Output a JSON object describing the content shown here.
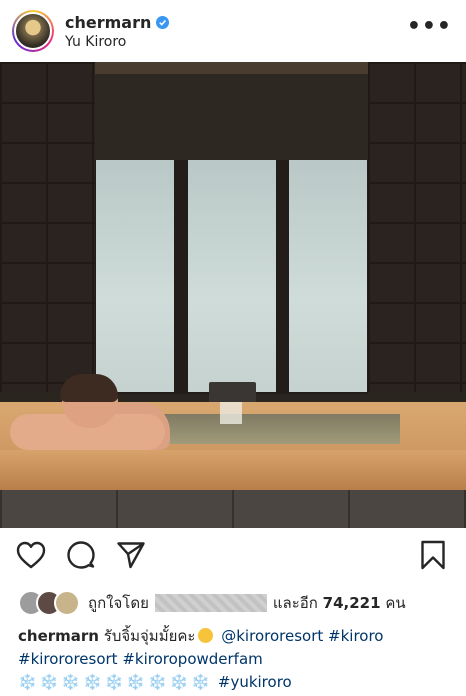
{
  "post": {
    "username": "chermarn",
    "verified": true,
    "location": "Yu Kiroro",
    "more_label": "•••"
  },
  "actions": {
    "like_icon": "heart-icon",
    "comment_icon": "comment-icon",
    "share_icon": "send-icon",
    "save_icon": "bookmark-icon"
  },
  "likes": {
    "prefix": "ถูกใจโดย",
    "and_more": "และอีก",
    "count": "74,221",
    "suffix": "คน"
  },
  "caption": {
    "username": "chermarn",
    "text": "รับจิ้มจุ่มมั้ยคะ",
    "emoji": "rolling-on-floor-laughing-emoji",
    "mention": "@kirororesort",
    "tag1": "#kiroro",
    "tag2": "#kirororesort",
    "tag3": "#kiroropowderfam",
    "snowflakes": "❄️❄️❄️❄️❄️❄️❄️❄️❄️",
    "tag4": "#yukiroro"
  },
  "colors": {
    "link": "#003569",
    "verified": "#3897f0",
    "text": "#262626"
  }
}
